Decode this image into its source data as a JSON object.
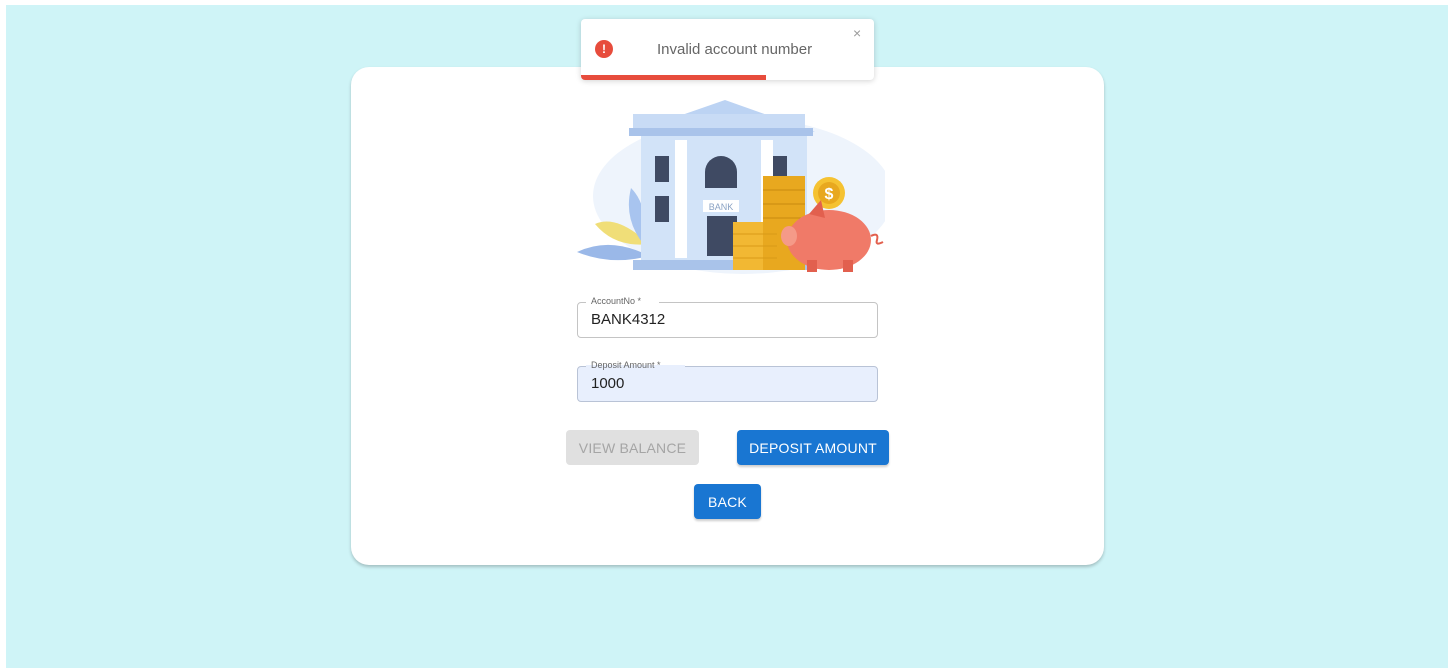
{
  "toast": {
    "message": "Invalid account number",
    "close_symbol": "×",
    "icon_symbol": "!",
    "icon": "error-icon",
    "color": "#e74c3c",
    "progress_fraction": 0.63
  },
  "illustration": {
    "sign_text": "BANK",
    "coin_symbol": "$"
  },
  "form": {
    "account": {
      "label": "AccountNo *",
      "value": "BANK4312"
    },
    "deposit": {
      "label": "Deposit Amount *",
      "value": "1000"
    }
  },
  "buttons": {
    "view_balance": "VIEW BALANCE",
    "deposit_amount": "DEPOSIT AMOUNT",
    "back": "BACK"
  },
  "colors": {
    "page_background": "#cff4f7",
    "primary": "#1976d2",
    "disabled": "#e0e0e0",
    "autofill_field": "#e8effd"
  }
}
